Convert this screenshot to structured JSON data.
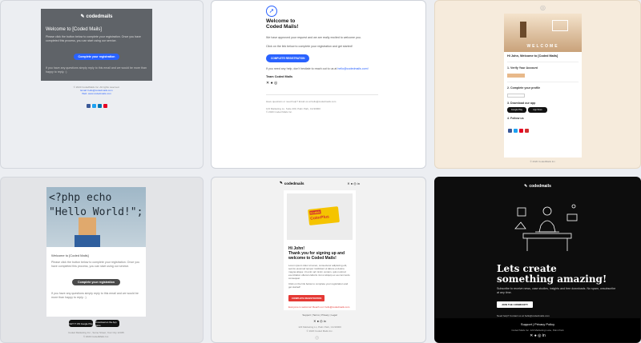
{
  "t1": {
    "logo": "codedmails",
    "title": "Welcome to [Coded Mails]",
    "body": "Please click the button below to complete your registration. Once you have completed this process, you can start using our service.",
    "button": "Complete your registration",
    "help": "If you have any questions simply reply to this email and we would be more than happy to reply. :)",
    "copyright": "© 2020 CodedMails Inc. All rights reserved.",
    "email1": "Email: hello@codedmails.com",
    "email2": "Web: www.codedmails.com",
    "colors": {
      "bg": "#5f6368",
      "accent": "#2962ff"
    }
  },
  "t2": {
    "heading1": "Welcome to",
    "heading2": "Coded Mails!",
    "p1": "We have approved your request and we are really excited to welcome you.",
    "p2": "Click on the link below to complete your registration and get started!",
    "button": "COMPLETE REGISTRATION",
    "help_a": "If you need any help, don't hesitate to reach out to us at",
    "help_link": "hello@codedmails.com!",
    "sign": "Team Coded Mails",
    "foot1": "Have questions or need help? Email us at hello@codedmails.com",
    "foot2": "123 Marketing Ln, Suite 400, Palm Park, CA 90000",
    "foot3": "© 2020 Coded Mails Inc.",
    "colors": {
      "accent": "#2962ff"
    }
  },
  "t3": {
    "hero_word": "WELCOME",
    "greeting": "Hi John, Welcome to [Coded Mails]",
    "step1": "1. Verify Your Account",
    "step2": "2. Complete your profile",
    "step3": "3. Download our app",
    "step4": "4. Follow us",
    "footer": "© 2020 CodedMails Inc.",
    "store1": "Google Play",
    "store2": "App Store",
    "colors": {
      "bg": "#f6ebdc",
      "accent": "#e8b98a"
    }
  },
  "t4": {
    "code1": "<?php echo",
    "code2": "\"Hello World!\";",
    "title": "Welcome to [Coded Mails]",
    "body": "Please click the button below to complete your registration. Once you have completed this process, you can start using our service.",
    "button": "Complete your registration",
    "help": "If you have any questions simply reply to this email and we would be more than happy to reply. :)",
    "store1": "GET IT ON Google Play",
    "store2": "Download on the App Store",
    "foot1": "Coded Marketing Inc., Some Street, Your City 12345",
    "foot2": "© 2020 CodedMails Inc.",
    "colors": {
      "accent": "#4a4a4a"
    }
  },
  "t5": {
    "logo": "codedmails",
    "film_brand": "Kodak",
    "film_name": "ColorPlus",
    "greeting": "Hi John!",
    "heading": "Thank you for signing up and welcome to Coded Mails!",
    "body": "Lorem ipsum dolor sit amet, consectetur adipiscing elit, sed do eiusmod tempor incididunt ut labore et dolore magna aliqua. Ut enim ad minim veniam, quis nostrud exercitation ullamco laboris nisi ut aliquip ex ea commodo consequat.",
    "cta_text": "Click on the link below to complete your registration and get started!",
    "button": "COMPLETE REGISTRATION",
    "help": "Everyone is welcome! Reach out: hello@codedmails.com",
    "links": [
      "Support",
      "Terms",
      "Privacy",
      "Legal"
    ],
    "foot1": "123 Marketing Ln, Palm Park, CA 90000",
    "foot2": "© 2020 Coded Mails Inc.",
    "colors": {
      "accent": "#e53935"
    }
  },
  "t6": {
    "logo": "codedmails",
    "heading1": "Lets create",
    "heading2": "something amazing!",
    "body": "Subscribe to receive news, case studies, insights and free downloads. No spam, unsubscribe at any time.",
    "button": "JOIN THE COMMUNITY",
    "contact": "Need help? Contact us at hello@codedmails.com",
    "links": "Support | Privacy Policy",
    "foot": "Coded Mails Inc. 123 Marketing Lane, Palm Park",
    "colors": {
      "bg": "#0d0d0d"
    }
  }
}
